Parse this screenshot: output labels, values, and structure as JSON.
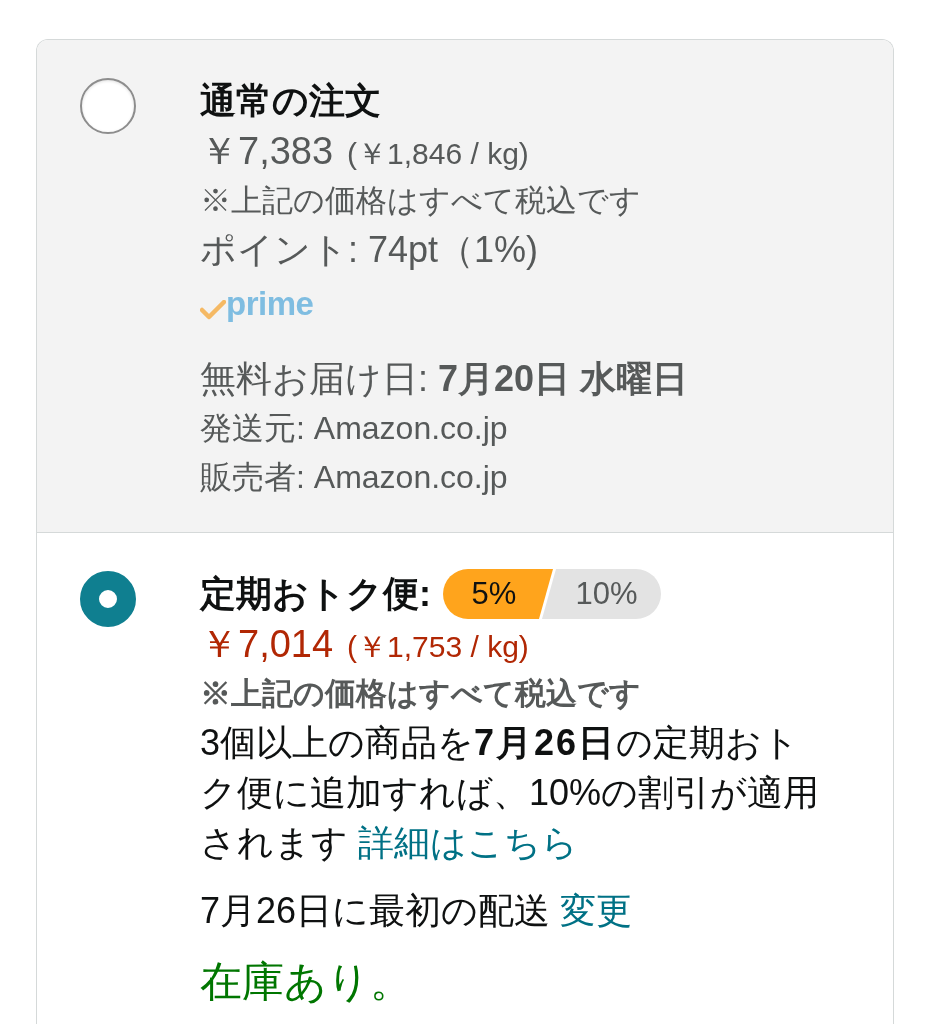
{
  "options": [
    {
      "kind": "one_time",
      "selected": false,
      "title": "通常の注文",
      "price": "￥7,383",
      "unit_price": "(￥1,846 / kg)",
      "tax_note": "※上記の価格はすべて税込です",
      "points": "ポイント: 74pt（1%)",
      "prime_logo": "prime",
      "delivery": "無料お届け日: **7月20日 水曜日**",
      "ships_from": "発送元: Amazon.co.jp",
      "sold_by": "販売者: Amazon.co.jp"
    },
    {
      "kind": "subscribe",
      "selected": true,
      "title": "定期おトク便:",
      "discount_tiers": [
        {
          "label": "5%",
          "selected": true
        },
        {
          "label": "10%",
          "selected": false
        }
      ],
      "price": "￥7,014",
      "unit_price": "(￥1,753 / kg)",
      "tax_note": "※上記の価格はすべて税込です",
      "promo": {
        "text": "3個以上の商品を**7月26日**の定期おトク便に追加すれば、10%の割引が適用されます",
        "link": "詳細はこちら"
      },
      "first_delivery": {
        "text": "7月26日に最初の配送",
        "link": "変更"
      },
      "stock": "在庫あり。"
    }
  ]
}
